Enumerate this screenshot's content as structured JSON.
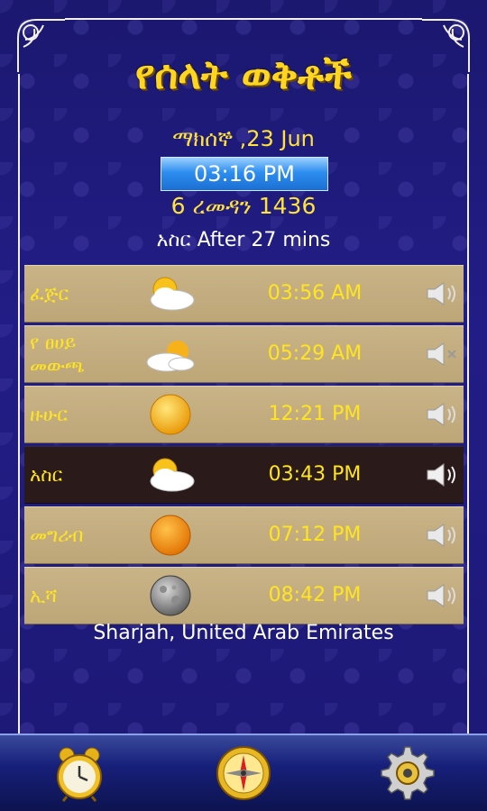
{
  "header": {
    "title": "የሰላት ወቅቶች",
    "date": "ማክሰኞ ,23 Jun",
    "current_time": "03:16 PM",
    "hijri_date": "6 ረመዳን 1436",
    "next_prayer": "አስር After 27 mins"
  },
  "prayers": [
    {
      "name": "ፈጅር",
      "time": "03:56 AM",
      "icon": "cloud-sun-icon",
      "sound": "on"
    },
    {
      "name": "የ ፀሀይ\nመውጫ",
      "time": "05:29 AM",
      "icon": "sunrise-cloud-icon",
      "sound": "muted"
    },
    {
      "name": "ዙሁር",
      "time": "12:21 PM",
      "icon": "sun-icon",
      "sound": "on"
    },
    {
      "name": "አስር",
      "time": "03:43 PM",
      "icon": "cloud-sun-icon",
      "sound": "on",
      "active": true
    },
    {
      "name": "መግሪብ",
      "time": "07:12 PM",
      "icon": "sunset-icon",
      "sound": "on"
    },
    {
      "name": "ኢሻ",
      "time": "08:42 PM",
      "icon": "moon-icon",
      "sound": "on"
    }
  ],
  "location": "Sharjah, United Arab Emirates",
  "nav": [
    {
      "icon": "alarm-clock-icon"
    },
    {
      "icon": "compass-icon"
    },
    {
      "icon": "settings-gear-icon"
    }
  ],
  "colors": {
    "background": "#1e1a7c",
    "gold_text": "#ffe51f",
    "row_bg": "#c4ae80",
    "active_row_bg": "#2a1a1a",
    "time_box": "#2d8ef0"
  }
}
